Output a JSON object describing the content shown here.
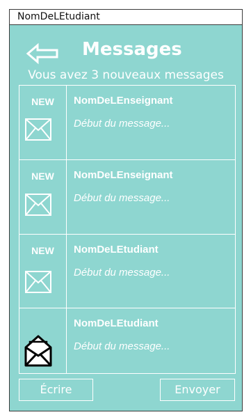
{
  "window": {
    "title": "NomDeLEtudiant"
  },
  "header": {
    "title": "Messages",
    "subtitle": "Vous avez 3 nouveaux messages"
  },
  "messages": [
    {
      "badge": "NEW",
      "sender": "NomDeLEnseignant",
      "preview": "Début du message...",
      "state": "unread"
    },
    {
      "badge": "NEW",
      "sender": "NomDeLEnseignant",
      "preview": "Début du message...",
      "state": "unread"
    },
    {
      "badge": "NEW",
      "sender": "NomDeLEtudiant",
      "preview": "Début du message...",
      "state": "unread"
    },
    {
      "badge": "",
      "sender": "NomDeLEtudiant",
      "preview": "Début du message...",
      "state": "read"
    }
  ],
  "footer": {
    "write_label": "Écrire",
    "send_label": "Envoyer"
  },
  "colors": {
    "background": "#8ed6d0",
    "foreground": "#ffffff",
    "frame": "#3a3a3a"
  },
  "icons": {
    "back": "back-arrow-icon",
    "unread": "closed-envelope-icon",
    "read": "open-envelope-icon"
  }
}
